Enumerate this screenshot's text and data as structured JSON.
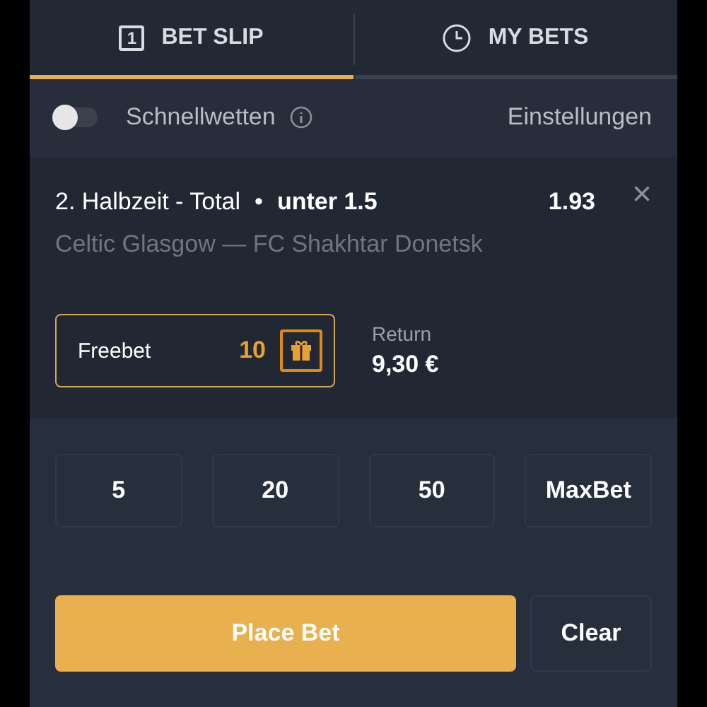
{
  "tabs": [
    {
      "label": "BET SLIP",
      "kind": "count",
      "badge": "1",
      "selected": true
    },
    {
      "label": "MY BETS",
      "kind": "clock",
      "selected": false
    }
  ],
  "quick_bets": {
    "label": "Schnellwetten",
    "on": false,
    "settings": "Einstellungen"
  },
  "bet": {
    "market": "2. Halbzeit - Total",
    "separator": "•",
    "selection": "unter 1.5",
    "odds": "1.93",
    "close": "×",
    "event": "Celtic Glasgow — FC Shakhtar Donetsk"
  },
  "stake": {
    "label": "Freebet",
    "value": "10",
    "return_label": "Return",
    "return_value": "9,30 €"
  },
  "amounts": [
    "5",
    "20",
    "50",
    "MaxBet"
  ],
  "actions": {
    "place": "Place Bet",
    "clear": "Clear"
  }
}
